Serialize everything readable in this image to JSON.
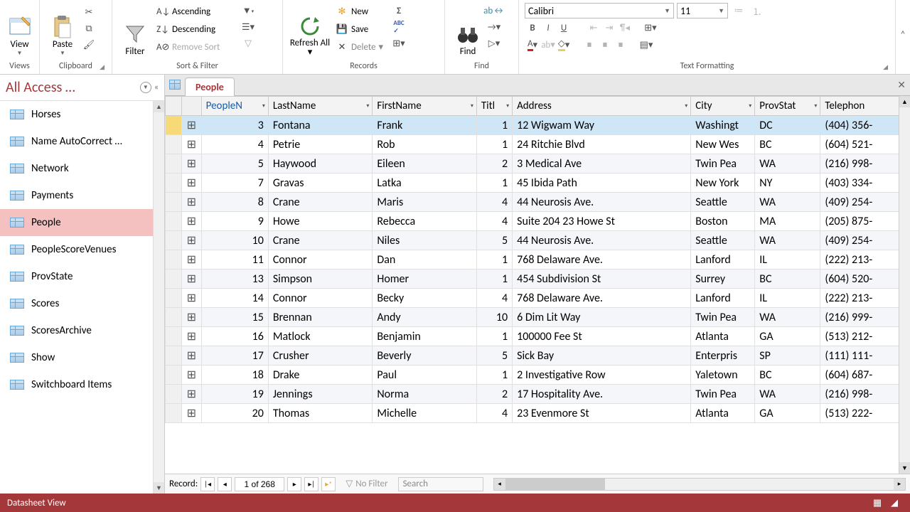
{
  "ribbon": {
    "view_label": "View",
    "paste_label": "Paste",
    "filter_label": "Filter",
    "ascending": "Ascending",
    "descending": "Descending",
    "remove_sort": "Remove Sort",
    "refresh_label": "Refresh All",
    "new": "New",
    "save": "Save",
    "delete": "Delete",
    "find_label": "Find",
    "font_name": "Calibri",
    "font_size": "11",
    "groups": {
      "views": "Views",
      "clipboard": "Clipboard",
      "sort_filter": "Sort & Filter",
      "records": "Records",
      "find": "Find",
      "text_formatting": "Text Formatting"
    }
  },
  "nav": {
    "title": "All Access …",
    "items": [
      "Horses",
      "Name AutoCorrect …",
      "Network",
      "Payments",
      "People",
      "PeopleScoreVenues",
      "ProvState",
      "Scores",
      "ScoresArchive",
      "Show",
      "Switchboard Items"
    ],
    "selected_index": 4
  },
  "tab": {
    "label": "People"
  },
  "columns": [
    "",
    "",
    "PeopleN",
    "LastName",
    "FirstName",
    "Titl",
    "Address",
    "City",
    "ProvStat",
    "Telephon"
  ],
  "rows": [
    {
      "id": "3",
      "last": "Fontana",
      "first": "Frank",
      "title": "1",
      "addr": "12 Wigwam Way",
      "city": "Washingt",
      "prov": "DC",
      "tel": "(404) 356-"
    },
    {
      "id": "4",
      "last": "Petrie",
      "first": "Rob",
      "title": "1",
      "addr": "24 Ritchie Blvd",
      "city": "New Wes",
      "prov": "BC",
      "tel": "(604) 521-"
    },
    {
      "id": "5",
      "last": "Haywood",
      "first": "Eileen",
      "title": "2",
      "addr": "3 Medical Ave",
      "city": "Twin Pea",
      "prov": "WA",
      "tel": "(216) 998-"
    },
    {
      "id": "7",
      "last": "Gravas",
      "first": "Latka",
      "title": "1",
      "addr": "45 Ibida Path",
      "city": "New York",
      "prov": "NY",
      "tel": "(403) 334-"
    },
    {
      "id": "8",
      "last": "Crane",
      "first": "Maris",
      "title": "4",
      "addr": "44 Neurosis Ave.",
      "city": "Seattle",
      "prov": "WA",
      "tel": "(409) 254-"
    },
    {
      "id": "9",
      "last": "Howe",
      "first": "Rebecca",
      "title": "4",
      "addr": "Suite 204 23 Howe St",
      "city": "Boston",
      "prov": "MA",
      "tel": "(205) 875-"
    },
    {
      "id": "10",
      "last": "Crane",
      "first": "Niles",
      "title": "5",
      "addr": "44 Neurosis Ave.",
      "city": "Seattle",
      "prov": "WA",
      "tel": "(409) 254-"
    },
    {
      "id": "11",
      "last": "Connor",
      "first": "Dan",
      "title": "1",
      "addr": "768 Delaware Ave.",
      "city": "Lanford",
      "prov": "IL",
      "tel": "(222) 213-"
    },
    {
      "id": "13",
      "last": "Simpson",
      "first": "Homer",
      "title": "1",
      "addr": "454 Subdivision St",
      "city": "Surrey",
      "prov": "BC",
      "tel": "(604) 520-"
    },
    {
      "id": "14",
      "last": "Connor",
      "first": "Becky",
      "title": "4",
      "addr": "768 Delaware Ave.",
      "city": "Lanford",
      "prov": "IL",
      "tel": "(222) 213-"
    },
    {
      "id": "15",
      "last": "Brennan",
      "first": "Andy",
      "title": "10",
      "addr": "6 Dim Lit Way",
      "city": "Twin Pea",
      "prov": "WA",
      "tel": "(216) 999-"
    },
    {
      "id": "16",
      "last": "Matlock",
      "first": "Benjamin",
      "title": "1",
      "addr": "100000 Fee St",
      "city": "Atlanta",
      "prov": "GA",
      "tel": "(513) 212-"
    },
    {
      "id": "17",
      "last": "Crusher",
      "first": "Beverly",
      "title": "5",
      "addr": "Sick Bay",
      "city": "Enterpris",
      "prov": "SP",
      "tel": "(111) 111-"
    },
    {
      "id": "18",
      "last": "Drake",
      "first": "Paul",
      "title": "1",
      "addr": "2 Investigative Row",
      "city": "Yaletown",
      "prov": "BC",
      "tel": "(604) 687-"
    },
    {
      "id": "19",
      "last": "Jennings",
      "first": "Norma",
      "title": "2",
      "addr": "17 Hospitality Ave.",
      "city": "Twin Pea",
      "prov": "WA",
      "tel": "(216) 998-"
    },
    {
      "id": "20",
      "last": "Thomas",
      "first": "Michelle",
      "title": "4",
      "addr": "23 Evenmore St",
      "city": "Atlanta",
      "prov": "GA",
      "tel": "(513) 222-"
    }
  ],
  "record_nav": {
    "label": "Record:",
    "position": "1 of 268",
    "no_filter": "No Filter",
    "search": "Search"
  },
  "status": {
    "view": "Datasheet View"
  }
}
